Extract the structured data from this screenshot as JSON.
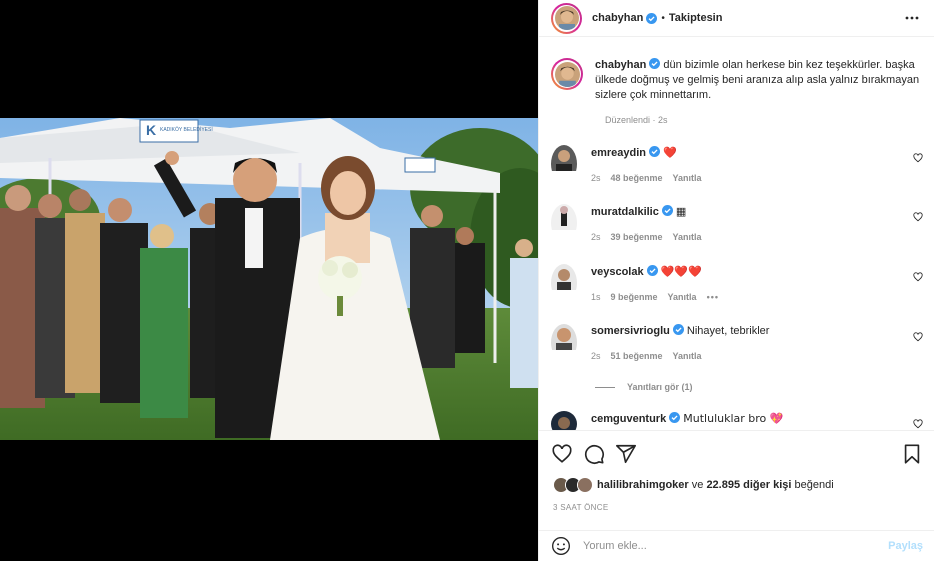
{
  "post": {
    "author": "chabyhan",
    "follow_status": "Takiptesin",
    "caption": "dün bizimle olan herkese bin kez teşekkürler. başka ülkede doğmuş ve gelmiş beni aranıza alıp asla yalnız bırakmayan sizlere çok minnettarım.",
    "edited": "Düzenlendi · 2s"
  },
  "photo": {
    "banner_text": "KADIKÖY BELEDİYESİ",
    "banner_letter": "K"
  },
  "comments": [
    {
      "user": "emreaydin",
      "text": "❤️",
      "time": "2s",
      "likes": "48 beğenme",
      "reply": "Yanıtla"
    },
    {
      "user": "muratdalkilic",
      "text": "▦",
      "time": "2s",
      "likes": "39 beğenme",
      "reply": "Yanıtla"
    },
    {
      "user": "veyscolak",
      "text": "❤️❤️❤️",
      "time": "1s",
      "likes": "9 beğenme",
      "reply": "Yanıtla"
    },
    {
      "user": "somersivrioglu",
      "text": "Nihayet, tebrikler",
      "time": "2s",
      "likes": "51 beğenme",
      "reply": "Yanıtla"
    },
    {
      "user": "cemguventurk",
      "text": "Mutluluklar bro 💖",
      "time": "",
      "likes": "",
      "reply": ""
    }
  ],
  "view_replies": "Yanıtları gör (1)",
  "likes_line": {
    "user": "halilibrahimgoker",
    "rest": " ve ",
    "count": "22.895 diğer kişi",
    "suffix": " beğendi"
  },
  "timestamp": "3 SAAT ÖNCE",
  "composer": {
    "placeholder": "Yorum ekle...",
    "post_label": "Paylaş"
  },
  "icons": [
    "heart-icon",
    "comment-icon",
    "share-icon",
    "bookmark-icon",
    "more-options-icon",
    "verified-badge-icon",
    "emoji-icon"
  ],
  "colors": {
    "verified": "#3897f0",
    "red_heart": "#ed4956",
    "link_disabled": "#b2dffc"
  }
}
